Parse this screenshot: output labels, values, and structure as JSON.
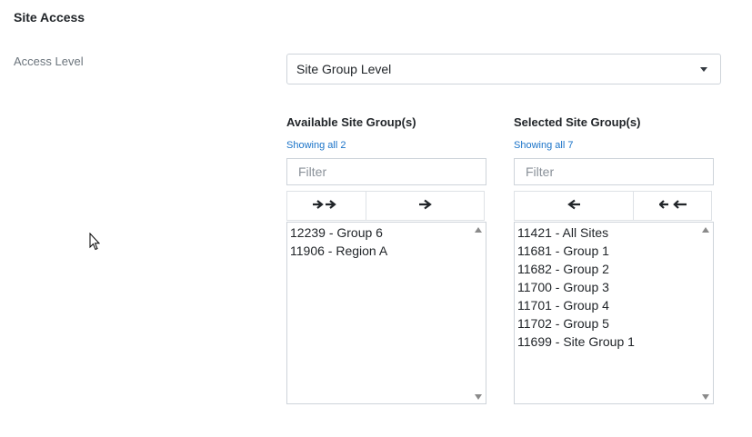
{
  "section": {
    "title": "Site Access"
  },
  "access_level": {
    "label": "Access Level",
    "selected": "Site Group Level"
  },
  "available": {
    "heading": "Available Site Group(s)",
    "showing": "Showing all 2",
    "filter_placeholder": "Filter",
    "move_all_icon": "➔➔",
    "move_selected_icon": "➔",
    "items": [
      "12239 - Group 6",
      "11906 - Region A"
    ]
  },
  "selected": {
    "heading": "Selected Site Group(s)",
    "showing": "Showing all 7",
    "filter_placeholder": "Filter",
    "remove_selected_icon": "🡐",
    "remove_all_icon": "🡐🡐",
    "items": [
      "11421 - All Sites",
      "11681 - Group 1",
      "11682 - Group 2",
      "11700 - Group 3",
      "11701 - Group 4",
      "11702 - Group 5",
      "11699 - Site Group 1"
    ]
  }
}
